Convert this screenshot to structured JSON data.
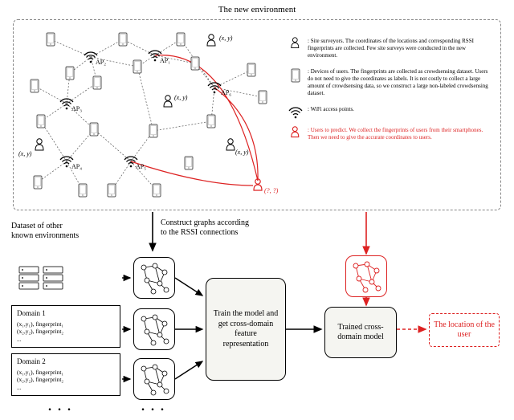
{
  "title": "The new environment",
  "legend": {
    "surveyor": ": Site surveyors. The coordinates of the locations and corresponding RSSI fingerprints are collected. Few site surveys were conducted in the new environment.",
    "device": ": Devices of users. The fingerprints are collected as crowdsensing dataset. Users do not need to give the coordinates as labels. It is not costly to collect a large amount of crowdsensing data, so we construct a large non-labeled crowdsensing dataset.",
    "wifi": ": WiFi access points.",
    "predict": ": Users to predict. We collect the fingerprints of users from their smartphones. Then we need to give the accurate coordinates to users."
  },
  "aps": {
    "ap1": "AP₁",
    "ap2": "AP₂",
    "ap3": "AP₃",
    "ap4": "AP₄",
    "ap5": "AP₅",
    "ap6": "AP₆"
  },
  "coord_xy": "(x, y)",
  "coord_unknown": "(?, ?)",
  "flow": {
    "construct": "Construct graphs according\nto the RSSI connections",
    "dataset_title": "Dataset of other\nknown environments",
    "domain1_title": "Domain 1",
    "domain2_title": "Domain 2",
    "domain_lines": "(x₁,y₁), fingerprint₁\n(x₂,y₂), fingerprint₂\n...",
    "train": "Train the model and get cross-domain feature representation",
    "trained": "Trained cross-domain model",
    "location": "The location of the user"
  }
}
